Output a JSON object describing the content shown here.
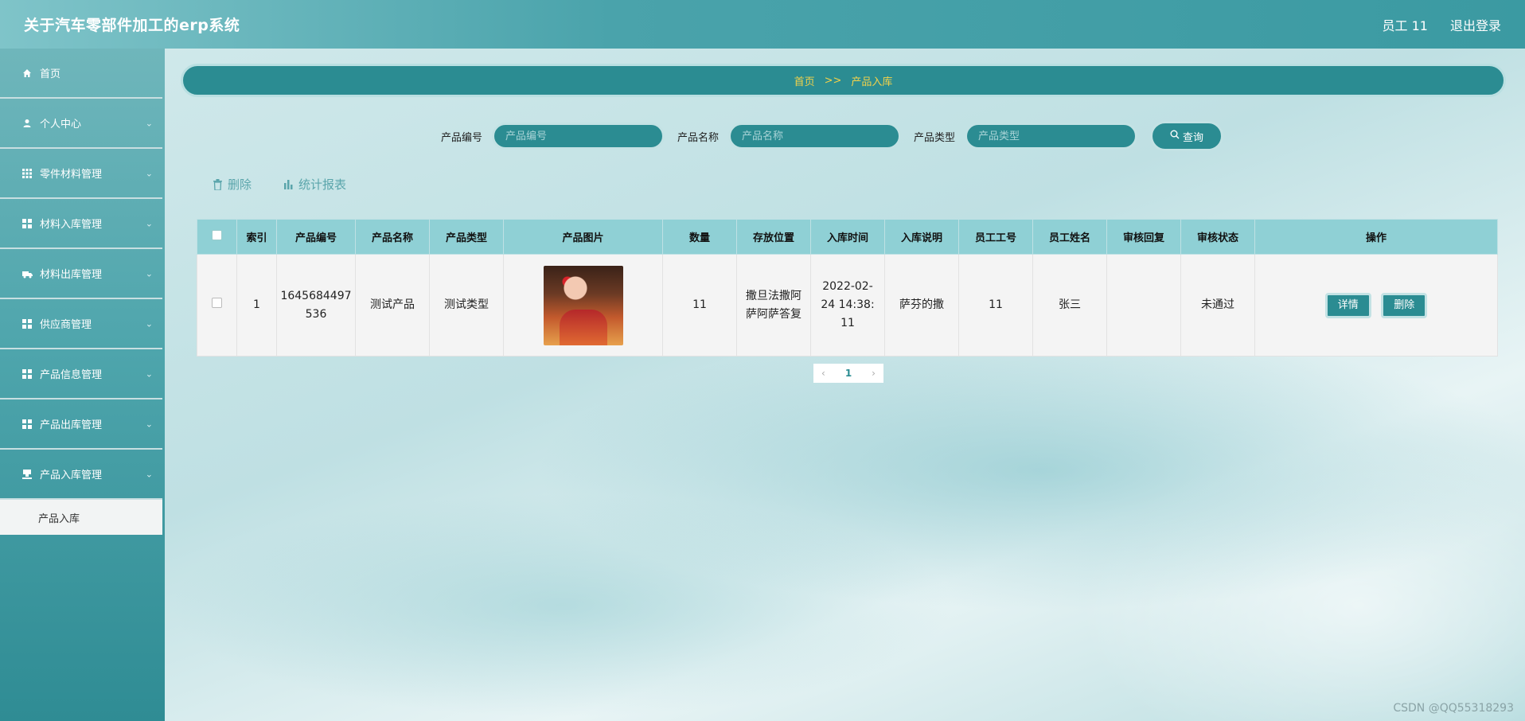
{
  "header": {
    "title": "关于汽车零部件加工的erp系统",
    "user": "员工 11",
    "logout": "退出登录"
  },
  "sidebar": {
    "items": [
      {
        "label": "首页",
        "icon": "home-icon"
      },
      {
        "label": "个人中心",
        "icon": "user-icon"
      },
      {
        "label": "零件材料管理",
        "icon": "grid-icon"
      },
      {
        "label": "材料入库管理",
        "icon": "grid-icon"
      },
      {
        "label": "材料出库管理",
        "icon": "truck-icon"
      },
      {
        "label": "供应商管理",
        "icon": "grid-icon"
      },
      {
        "label": "产品信息管理",
        "icon": "grid-icon"
      },
      {
        "label": "产品出库管理",
        "icon": "grid-icon"
      },
      {
        "label": "产品入库管理",
        "icon": "stamp-icon"
      }
    ],
    "sub_item": "产品入库"
  },
  "breadcrumb": {
    "home": "首页",
    "sep": ">>",
    "current": "产品入库"
  },
  "search": {
    "field1_label": "产品编号",
    "field1_placeholder": "产品编号",
    "field2_label": "产品名称",
    "field2_placeholder": "产品名称",
    "field3_label": "产品类型",
    "field3_placeholder": "产品类型",
    "query_label": "查询"
  },
  "toolbar": {
    "delete_label": "删除",
    "report_label": "统计报表"
  },
  "table": {
    "columns": [
      "索引",
      "产品编号",
      "产品名称",
      "产品类型",
      "产品图片",
      "数量",
      "存放位置",
      "入库时间",
      "入库说明",
      "员工工号",
      "员工姓名",
      "审核回复",
      "审核状态",
      "操作"
    ],
    "rows": [
      {
        "index": "1",
        "code": "1645684497536",
        "name": "测试产品",
        "type": "测试类型",
        "quantity": "11",
        "location": "撒旦法撒阿萨阿萨答复",
        "time": "2022-02-24 14:38:11",
        "note": "萨芬的撒",
        "emp_no": "11",
        "emp_name": "张三",
        "reply": "",
        "status": "未通过",
        "detail_btn": "详情",
        "delete_btn": "删除"
      }
    ]
  },
  "pager": {
    "current": "1"
  },
  "watermark": "CSDN @QQ55318293"
}
